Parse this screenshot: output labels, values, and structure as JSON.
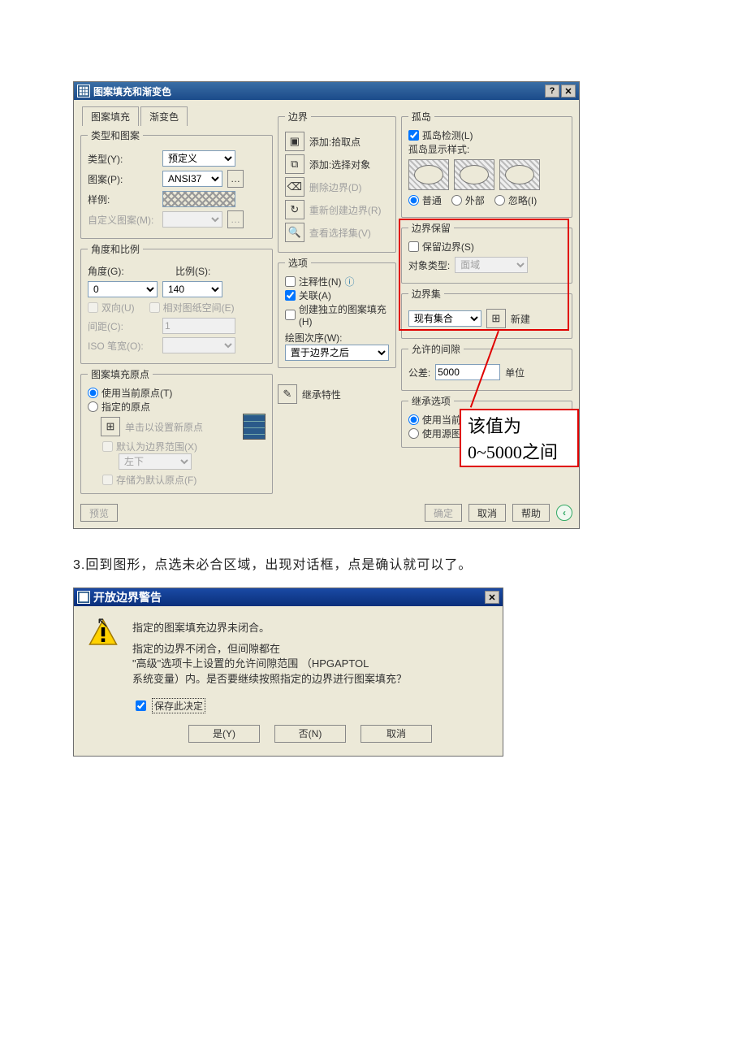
{
  "dlg1": {
    "title": "图案填充和渐变色",
    "tabs": {
      "hatch": "图案填充",
      "gradient": "渐变色"
    },
    "typePattern": {
      "legend": "类型和图案",
      "type_lbl": "类型(Y):",
      "type_val": "预定义",
      "pattern_lbl": "图案(P):",
      "pattern_val": "ANSI37",
      "sample_lbl": "样例:",
      "custom_lbl": "自定义图案(M):"
    },
    "angleScale": {
      "legend": "角度和比例",
      "angle_lbl": "角度(G):",
      "angle_val": "0",
      "scale_lbl": "比例(S):",
      "scale_val": "140",
      "double_lbl": "双向(U)",
      "relpaper_lbl": "相对图纸空间(E)",
      "spacing_lbl": "间距(C):",
      "spacing_val": "1",
      "iso_lbl": "ISO 笔宽(O):"
    },
    "hatchOrigin": {
      "legend": "图案填充原点",
      "use_current": "使用当前原点(T)",
      "specified": "指定的原点",
      "click_set": "单击以设置新原点",
      "default_ext": "默认为边界范围(X)",
      "pos_val": "左下",
      "store_default": "存储为默认原点(F)"
    },
    "boundary": {
      "legend": "边界",
      "add_pick": "添加:拾取点",
      "add_select": "添加:选择对象",
      "del_boundary": "删除边界(D)",
      "recreate": "重新创建边界(R)",
      "view_sel": "查看选择集(V)"
    },
    "options": {
      "legend": "选项",
      "annotative": "注释性(N)",
      "assoc": "关联(A)",
      "independent": "创建独立的图案填充(H)",
      "draworder_lbl": "绘图次序(W):",
      "draworder_val": "置于边界之后"
    },
    "inherit_btn": "继承特性",
    "islands": {
      "legend": "孤岛",
      "detect": "孤岛检测(L)",
      "style_lbl": "孤岛显示样式:",
      "normal": "普通",
      "outer": "外部",
      "ignore": "忽略(I)"
    },
    "bretain": {
      "legend": "边界保留",
      "retain": "保留边界(S)",
      "objtype_lbl": "对象类型:",
      "objtype_val": "面域"
    },
    "bset": {
      "legend": "边界集",
      "val": "现有集合",
      "new_btn": "新建"
    },
    "gap": {
      "legend": "允许的间隙",
      "tol_lbl": "公差:",
      "tol_val": "5000",
      "unit": "单位"
    },
    "inheritOpt": {
      "legend": "继承选项",
      "use_current": "使用当前原点",
      "use_source": "使用源图案填充的原点"
    },
    "preview_btn": "预览",
    "ok_btn": "确定",
    "cancel_btn": "取消",
    "help_btn": "帮助",
    "annotation": "该值为0~5000之间"
  },
  "instr": "3.回到图形，点选未必合区域，出现对话框，点是确认就可以了。",
  "dlg2": {
    "title": "开放边界警告",
    "msg1": "指定的图案填充边界未闭合。",
    "msg2a": "指定的边界不闭合，但间隙都在",
    "msg2b": "\"高级\"选项卡上设置的允许间隙范围 （HPGAPTOL",
    "msg2c": "系统变量）内。是否要继续按照指定的边界进行图案填充？",
    "save_dec": "保存此决定",
    "yes": "是(Y)",
    "no": "否(N)",
    "cancel": "取消"
  }
}
